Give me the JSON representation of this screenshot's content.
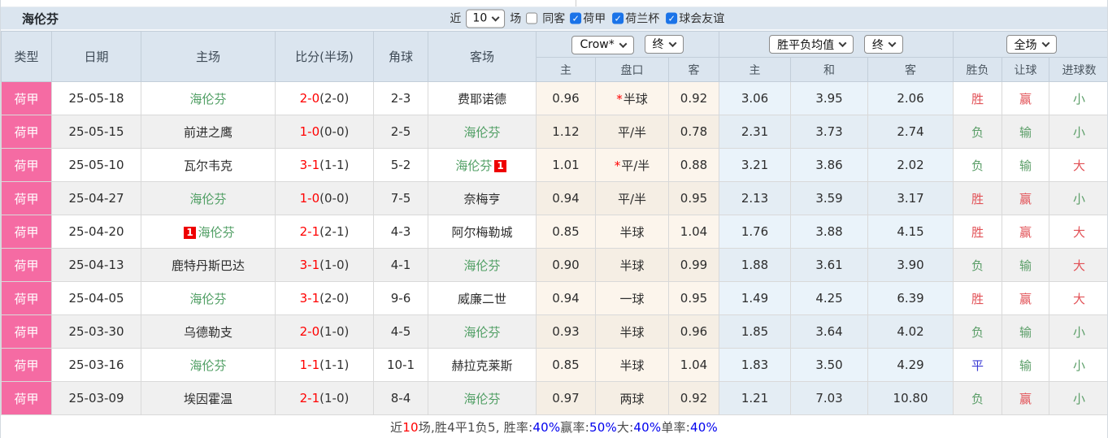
{
  "colors": {
    "league_pink": "#f56ba3",
    "header_bg": "#dbe5ef",
    "score_red": "#ff0000",
    "team_green": "#4f9e63",
    "win_red": "#e25257",
    "lose_green": "#5b9e68",
    "draw_blue": "#3b3bd4",
    "stat_blue": "#0000ee",
    "stat_red": "#ff0000",
    "check_blue": "#1a73e8",
    "asian_bg": "#fcf5ec",
    "euro_bg": "#eaf3fa"
  },
  "title": "海伦芬",
  "topbar": {
    "recent_label": "近",
    "recent_value": "10",
    "unit_label": "场",
    "same_away": {
      "label": "同客",
      "checked": false
    },
    "filters": [
      {
        "label": "荷甲",
        "checked": true
      },
      {
        "label": "荷兰杯",
        "checked": true
      },
      {
        "label": "球会友谊",
        "checked": true
      }
    ]
  },
  "header": {
    "static_cols": [
      "类型",
      "日期",
      "主场",
      "比分(半场)",
      "角球",
      "客场"
    ],
    "asian": {
      "bookmaker": "Crow*",
      "time": "终",
      "sub": [
        "主",
        "盘口",
        "客"
      ]
    },
    "europe": {
      "bookmaker": "胜平负均值",
      "time": "终",
      "sub": [
        "主",
        "和",
        "客"
      ]
    },
    "result": {
      "scope": "全场",
      "sub": [
        "胜负",
        "让球",
        "进球数"
      ]
    }
  },
  "rows": [
    {
      "league": "荷甲",
      "date": "25-05-18",
      "home": {
        "name": "海伦芬",
        "focus": true
      },
      "score": {
        "ft": "2-0",
        "ht": "(2-0)"
      },
      "corner": "2-3",
      "away": {
        "name": "费耶诺德",
        "focus": false
      },
      "asian": {
        "home": "0.96",
        "star": true,
        "line": "半球",
        "away": "0.92"
      },
      "europe": {
        "home": "3.06",
        "draw": "3.95",
        "away": "2.06"
      },
      "result": {
        "wdl": {
          "text": "胜",
          "color": "red"
        },
        "handicap": {
          "text": "赢",
          "color": "red"
        },
        "goals": {
          "text": "小",
          "color": "green"
        }
      }
    },
    {
      "league": "荷甲",
      "date": "25-05-15",
      "home": {
        "name": "前进之鹰",
        "focus": false
      },
      "score": {
        "ft": "1-0",
        "ht": "(0-0)"
      },
      "corner": "2-5",
      "away": {
        "name": "海伦芬",
        "focus": true
      },
      "asian": {
        "home": "1.12",
        "star": false,
        "line": "平/半",
        "away": "0.78"
      },
      "europe": {
        "home": "2.31",
        "draw": "3.73",
        "away": "2.74"
      },
      "result": {
        "wdl": {
          "text": "负",
          "color": "green"
        },
        "handicap": {
          "text": "输",
          "color": "green"
        },
        "goals": {
          "text": "小",
          "color": "green"
        }
      }
    },
    {
      "league": "荷甲",
      "date": "25-05-10",
      "home": {
        "name": "瓦尔韦克",
        "focus": false
      },
      "score": {
        "ft": "3-1",
        "ht": "(1-1)"
      },
      "corner": "5-2",
      "away": {
        "name": "海伦芬",
        "focus": true,
        "card": "1",
        "card_pos": "after"
      },
      "asian": {
        "home": "1.01",
        "star": true,
        "line": "平/半",
        "away": "0.88"
      },
      "europe": {
        "home": "3.21",
        "draw": "3.86",
        "away": "2.02"
      },
      "result": {
        "wdl": {
          "text": "负",
          "color": "green"
        },
        "handicap": {
          "text": "输",
          "color": "green"
        },
        "goals": {
          "text": "大",
          "color": "red"
        }
      }
    },
    {
      "league": "荷甲",
      "date": "25-04-27",
      "home": {
        "name": "海伦芬",
        "focus": true
      },
      "score": {
        "ft": "1-0",
        "ht": "(0-0)"
      },
      "corner": "7-5",
      "away": {
        "name": "奈梅亨",
        "focus": false
      },
      "asian": {
        "home": "0.94",
        "star": false,
        "line": "平/半",
        "away": "0.95"
      },
      "europe": {
        "home": "2.13",
        "draw": "3.59",
        "away": "3.17"
      },
      "result": {
        "wdl": {
          "text": "胜",
          "color": "red"
        },
        "handicap": {
          "text": "赢",
          "color": "red"
        },
        "goals": {
          "text": "小",
          "color": "green"
        }
      }
    },
    {
      "league": "荷甲",
      "date": "25-04-20",
      "home": {
        "name": "海伦芬",
        "focus": true,
        "card": "1",
        "card_pos": "before"
      },
      "score": {
        "ft": "2-1",
        "ht": "(2-1)"
      },
      "corner": "4-3",
      "away": {
        "name": "阿尔梅勒城",
        "focus": false
      },
      "asian": {
        "home": "0.85",
        "star": false,
        "line": "半球",
        "away": "1.04"
      },
      "europe": {
        "home": "1.76",
        "draw": "3.88",
        "away": "4.15"
      },
      "result": {
        "wdl": {
          "text": "胜",
          "color": "red"
        },
        "handicap": {
          "text": "赢",
          "color": "red"
        },
        "goals": {
          "text": "大",
          "color": "red"
        }
      }
    },
    {
      "league": "荷甲",
      "date": "25-04-13",
      "home": {
        "name": "鹿特丹斯巴达",
        "focus": false
      },
      "score": {
        "ft": "3-1",
        "ht": "(1-0)"
      },
      "corner": "4-1",
      "away": {
        "name": "海伦芬",
        "focus": true
      },
      "asian": {
        "home": "0.90",
        "star": false,
        "line": "半球",
        "away": "0.99"
      },
      "europe": {
        "home": "1.88",
        "draw": "3.61",
        "away": "3.90"
      },
      "result": {
        "wdl": {
          "text": "负",
          "color": "green"
        },
        "handicap": {
          "text": "输",
          "color": "green"
        },
        "goals": {
          "text": "大",
          "color": "red"
        }
      }
    },
    {
      "league": "荷甲",
      "date": "25-04-05",
      "home": {
        "name": "海伦芬",
        "focus": true
      },
      "score": {
        "ft": "3-1",
        "ht": "(2-0)"
      },
      "corner": "9-6",
      "away": {
        "name": "威廉二世",
        "focus": false
      },
      "asian": {
        "home": "0.94",
        "star": false,
        "line": "一球",
        "away": "0.95"
      },
      "europe": {
        "home": "1.49",
        "draw": "4.25",
        "away": "6.39"
      },
      "result": {
        "wdl": {
          "text": "胜",
          "color": "red"
        },
        "handicap": {
          "text": "赢",
          "color": "red"
        },
        "goals": {
          "text": "大",
          "color": "red"
        }
      }
    },
    {
      "league": "荷甲",
      "date": "25-03-30",
      "home": {
        "name": "乌德勒支",
        "focus": false
      },
      "score": {
        "ft": "2-0",
        "ht": "(1-0)"
      },
      "corner": "4-5",
      "away": {
        "name": "海伦芬",
        "focus": true
      },
      "asian": {
        "home": "0.93",
        "star": false,
        "line": "半球",
        "away": "0.96"
      },
      "europe": {
        "home": "1.85",
        "draw": "3.64",
        "away": "4.02"
      },
      "result": {
        "wdl": {
          "text": "负",
          "color": "green"
        },
        "handicap": {
          "text": "输",
          "color": "green"
        },
        "goals": {
          "text": "小",
          "color": "green"
        }
      }
    },
    {
      "league": "荷甲",
      "date": "25-03-16",
      "home": {
        "name": "海伦芬",
        "focus": true
      },
      "score": {
        "ft": "1-1",
        "ht": "(1-1)"
      },
      "corner": "10-1",
      "away": {
        "name": "赫拉克莱斯",
        "focus": false
      },
      "asian": {
        "home": "0.85",
        "star": false,
        "line": "半球",
        "away": "1.04"
      },
      "europe": {
        "home": "1.83",
        "draw": "3.50",
        "away": "4.29"
      },
      "result": {
        "wdl": {
          "text": "平",
          "color": "blue"
        },
        "handicap": {
          "text": "输",
          "color": "green"
        },
        "goals": {
          "text": "小",
          "color": "green"
        }
      }
    },
    {
      "league": "荷甲",
      "date": "25-03-09",
      "home": {
        "name": "埃因霍温",
        "focus": false
      },
      "score": {
        "ft": "2-1",
        "ht": "(1-0)"
      },
      "corner": "8-4",
      "away": {
        "name": "海伦芬",
        "focus": true
      },
      "asian": {
        "home": "0.97",
        "star": false,
        "line": "两球",
        "away": "0.92"
      },
      "europe": {
        "home": "1.21",
        "draw": "7.03",
        "away": "10.80"
      },
      "result": {
        "wdl": {
          "text": "负",
          "color": "green"
        },
        "handicap": {
          "text": "赢",
          "color": "red"
        },
        "goals": {
          "text": "小",
          "color": "green"
        }
      }
    }
  ],
  "footer": {
    "segments": [
      {
        "text": "近",
        "color": "dark"
      },
      {
        "text": "10",
        "color": "red"
      },
      {
        "text": "场,胜4平1负5, 胜率:",
        "color": "dark"
      },
      {
        "text": "40%",
        "color": "blue"
      },
      {
        "text": " 赢率:",
        "color": "dark"
      },
      {
        "text": "50%",
        "color": "blue"
      },
      {
        "text": " 大:",
        "color": "dark"
      },
      {
        "text": "40%",
        "color": "blue"
      },
      {
        "text": " 单率:",
        "color": "dark"
      },
      {
        "text": "40%",
        "color": "blue"
      }
    ]
  }
}
